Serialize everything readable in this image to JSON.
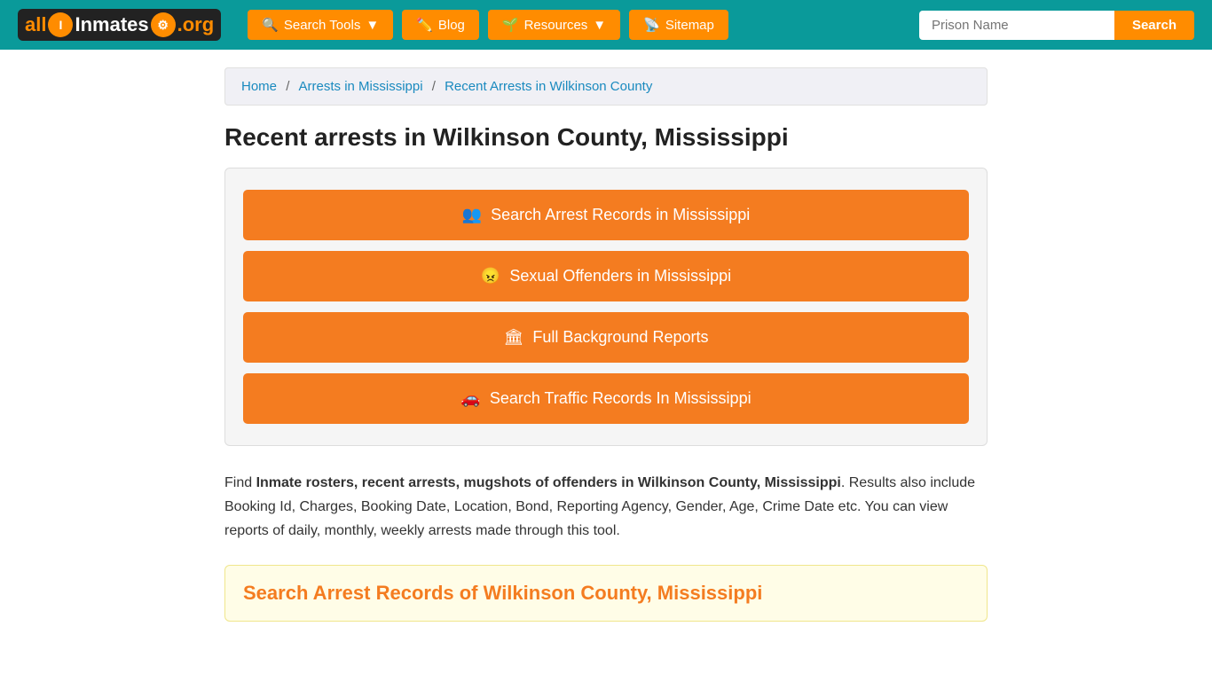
{
  "header": {
    "logo": {
      "text_all": "all",
      "text_inmates": "Inmates",
      "text_org": ".org"
    },
    "nav": [
      {
        "id": "search-tools",
        "label": "Search Tools",
        "icon": "🔍",
        "has_dropdown": true
      },
      {
        "id": "blog",
        "label": "Blog",
        "icon": "✏️",
        "has_dropdown": false
      },
      {
        "id": "resources",
        "label": "Resources",
        "icon": "🌱",
        "has_dropdown": true
      },
      {
        "id": "sitemap",
        "label": "Sitemap",
        "icon": "📡",
        "has_dropdown": false
      }
    ],
    "search_placeholder": "Prison Name",
    "search_button_label": "Search"
  },
  "breadcrumb": {
    "items": [
      {
        "label": "Home",
        "href": "#"
      },
      {
        "label": "Arrests in Mississippi",
        "href": "#"
      },
      {
        "label": "Recent Arrests in Wilkinson County",
        "href": "#"
      }
    ]
  },
  "page": {
    "title": "Recent arrests in Wilkinson County, Mississippi",
    "buttons": [
      {
        "id": "arrest-records",
        "icon": "👥",
        "label": "Search Arrest Records in Mississippi"
      },
      {
        "id": "sex-offenders",
        "icon": "😠",
        "label": "Sexual Offenders in Mississippi"
      },
      {
        "id": "background-reports",
        "icon": "🏛",
        "label": "Full Background Reports"
      },
      {
        "id": "traffic-records",
        "icon": "🚗",
        "label": "Search Traffic Records In Mississippi"
      }
    ],
    "description": {
      "prefix": "Find ",
      "bold_text": "Inmate rosters, recent arrests, mugshots of offenders in Wilkinson County, Mississippi",
      "suffix": ". Results also include Booking Id, Charges, Booking Date, Location, Bond, Reporting Agency, Gender, Age, Crime Date etc. You can view reports of daily, monthly, weekly arrests made through this tool."
    },
    "search_section_title": "Search Arrest Records of Wilkinson County, Mississippi"
  }
}
